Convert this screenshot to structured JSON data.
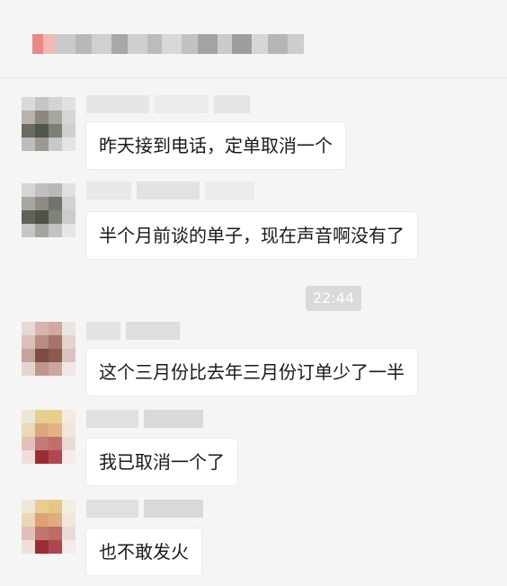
{
  "header": {
    "title_icon": "chat-group-icon"
  },
  "messages": [
    {
      "text": "昨天接到电话，定单取消一个"
    },
    {
      "text": "半个月前谈的单子，现在声音啊没有了"
    },
    {
      "text": "这个三月份比去年三月份订单少了一半"
    },
    {
      "text": "我已取消一个了"
    },
    {
      "text": "也不敢发火"
    }
  ],
  "timestamp": "22:44",
  "colors": {
    "background": "#f5f5f5",
    "bubble": "#ffffff",
    "timestamp_bg": "#dadada",
    "text": "#1a1a1a"
  }
}
